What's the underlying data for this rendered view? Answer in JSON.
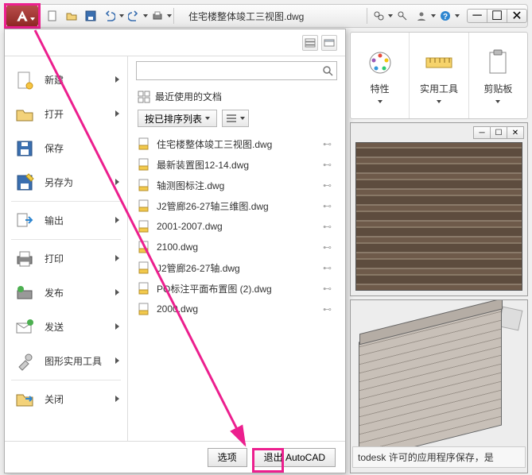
{
  "titlebar": {
    "doc_title": "住宅楼整体竣工三视图.dwg"
  },
  "qat": {
    "items": [
      "new",
      "open",
      "save",
      "undo",
      "redo",
      "print"
    ],
    "help_items": [
      "binoculars",
      "key",
      "user",
      "help"
    ]
  },
  "ribbon": {
    "panels": [
      {
        "label": "特性",
        "icon": "palette"
      },
      {
        "label": "实用工具",
        "icon": "ruler"
      },
      {
        "label": "剪贴板",
        "icon": "clipboard"
      }
    ]
  },
  "app_menu": {
    "search_placeholder": "",
    "recent_header": "最近使用的文档",
    "sort_label": "按已排序列表",
    "left": [
      {
        "label": "新建",
        "icon": "file-new",
        "arrow": true
      },
      {
        "label": "打开",
        "icon": "file-open",
        "arrow": true
      },
      {
        "label": "保存",
        "icon": "save",
        "arrow": false
      },
      {
        "label": "另存为",
        "icon": "save-as",
        "arrow": true
      },
      {
        "label": "输出",
        "icon": "export",
        "arrow": true
      },
      {
        "label": "打印",
        "icon": "print",
        "arrow": true
      },
      {
        "label": "发布",
        "icon": "publish",
        "arrow": true
      },
      {
        "label": "发送",
        "icon": "send",
        "arrow": true
      },
      {
        "label": "图形实用工具",
        "icon": "tools",
        "arrow": true
      },
      {
        "label": "关闭",
        "icon": "close-file",
        "arrow": true
      }
    ],
    "recent": [
      "住宅楼整体竣工三视图.dwg",
      "最新装置图12-14.dwg",
      "轴测图标注.dwg",
      "J2管廊26-27轴三维图.dwg",
      "2001-2007.dwg",
      "2100.dwg",
      "J2管廊26-27轴.dwg",
      "PO标注平面布置图 (2).dwg",
      "2000.dwg"
    ],
    "footer": {
      "options": "选项",
      "exit": "退出 AutoCAD"
    }
  },
  "status_text": "todesk 许可的应用程序保存，是"
}
